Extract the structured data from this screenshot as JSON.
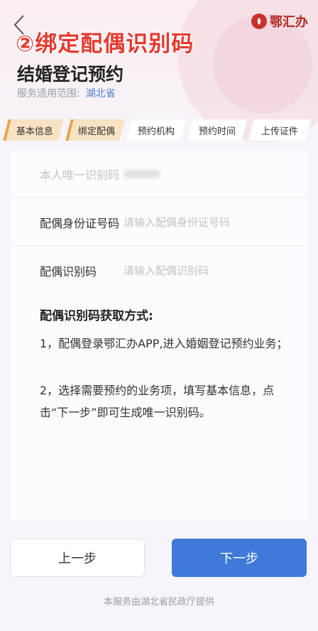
{
  "overlay": {
    "title": "②绑定配偶识别码"
  },
  "brand": {
    "name": "鄂汇办"
  },
  "header": {
    "title": "结婚登记预约",
    "scope_label": "服务适用范围:",
    "scope_value": "湖北省"
  },
  "steps": [
    {
      "label": "基本信息",
      "state": "done"
    },
    {
      "label": "绑定配偶",
      "state": "done"
    },
    {
      "label": "预约机构",
      "state": "todo"
    },
    {
      "label": "预约时间",
      "state": "todo"
    },
    {
      "label": "上传证件",
      "state": "todo"
    }
  ],
  "form": {
    "own_code_label": "本人唯一识别码",
    "spouse_id_label": "配偶身份证号码",
    "spouse_id_placeholder": "请输入配偶身份证号码",
    "spouse_code_label": "配偶识别码",
    "spouse_code_placeholder": "请输入配偶识别码"
  },
  "help": {
    "title": "配偶识别码获取方式:",
    "item1": "1，配偶登录鄂汇办APP,进入婚姻登记预约业务；",
    "item2": "2，选择需要预约的业务项，填写基本信息，点击“下一步”即可生成唯一识别码。"
  },
  "buttons": {
    "prev": "上一步",
    "next": "下一步"
  },
  "footer": {
    "text": "本服务由湖北省民政厅提供"
  },
  "colors": {
    "accent": "#3f7ad9",
    "overlay_red": "#e33a2f",
    "step_done": "#f7e3c2"
  }
}
